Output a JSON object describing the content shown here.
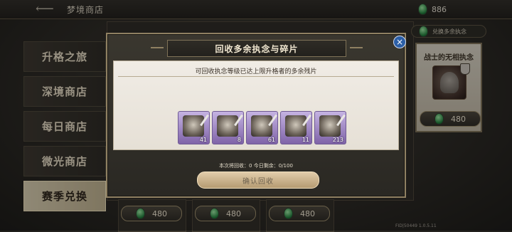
{
  "top_bar": {
    "title": "梦境商店",
    "currency_value": "886"
  },
  "sidebar": {
    "items": [
      {
        "label": "升格之旅"
      },
      {
        "label": "深境商店"
      },
      {
        "label": "每日商店"
      },
      {
        "label": "微光商店"
      },
      {
        "label": "赛季兑换"
      }
    ],
    "active_index": 4
  },
  "right_panel": {
    "pill_label": "兑换多余执念",
    "card_title": "战士的无相执念",
    "price": "480"
  },
  "bottom_prices": [
    "480",
    "480",
    "480"
  ],
  "fid": "FID|50449  1.0.5.11",
  "modal": {
    "title": "回收多余执念与碎片",
    "subtitle": "可回收执念等级已达上限升格者的多余残片",
    "items": [
      {
        "count": "41"
      },
      {
        "count": "8"
      },
      {
        "count": "61"
      },
      {
        "count": "11"
      },
      {
        "count": "213"
      }
    ],
    "stats_text": "本次将回收：0    今日剩余：0/100",
    "confirm_label": "确认回收",
    "close_symbol": "×"
  },
  "colors": {
    "accent_gold": "#bfb18f",
    "close_blue": "#2c5fa7",
    "item_purple": "#7f63a8"
  }
}
